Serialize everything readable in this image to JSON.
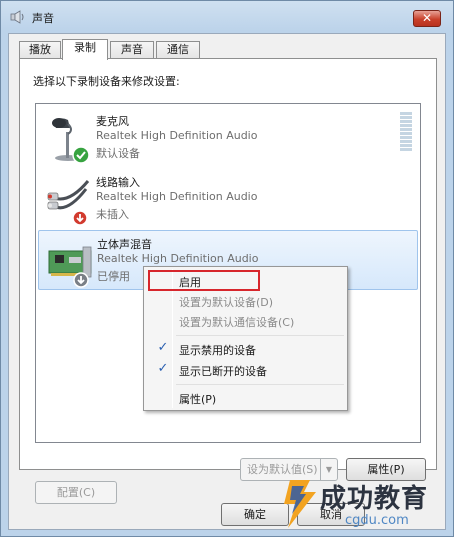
{
  "window": {
    "title": "声音",
    "close_glyph": "✕"
  },
  "tabs": [
    {
      "label": "播放"
    },
    {
      "label": "录制",
      "active": true
    },
    {
      "label": "声音"
    },
    {
      "label": "通信"
    }
  ],
  "panel": {
    "instruction": "选择以下录制设备来修改设置:"
  },
  "devices": [
    {
      "name": "麦克风",
      "driver": "Realtek High Definition Audio",
      "status": "默认设备",
      "icon": "microphone-icon",
      "badge": "green-check"
    },
    {
      "name": "线路输入",
      "driver": "Realtek High Definition Audio",
      "status": "未插入",
      "icon": "line-in-cable-icon",
      "badge": "red-down-arrow"
    },
    {
      "name": "立体声混音",
      "driver": "Realtek High Definition Audio",
      "status": "已停用",
      "icon": "sound-card-icon",
      "badge": "gray-down-arrow",
      "selected": true
    }
  ],
  "context_menu": {
    "items": [
      {
        "label": "启用",
        "enabled": true,
        "highlighted": true
      },
      {
        "label": "设置为默认设备(D)",
        "enabled": false
      },
      {
        "label": "设置为默认通信设备(C)",
        "enabled": false
      },
      {
        "label": "显示禁用的设备",
        "checked": true
      },
      {
        "label": "显示已断开的设备",
        "checked": true
      },
      {
        "label": "属性(P)"
      }
    ],
    "check_glyph": "✓"
  },
  "buttons": {
    "configure": "配置(C)",
    "set_default": "设为默认值(S)",
    "set_default_arrow": "▼",
    "properties": "属性(P)",
    "ok": "确定",
    "cancel": "取消"
  },
  "watermark": {
    "text": "成功教育",
    "url": "cgdu.com"
  },
  "colors": {
    "selection": "#d6e8fb",
    "check_accent": "#2a5fb0",
    "highlight_box": "#d7262c"
  }
}
